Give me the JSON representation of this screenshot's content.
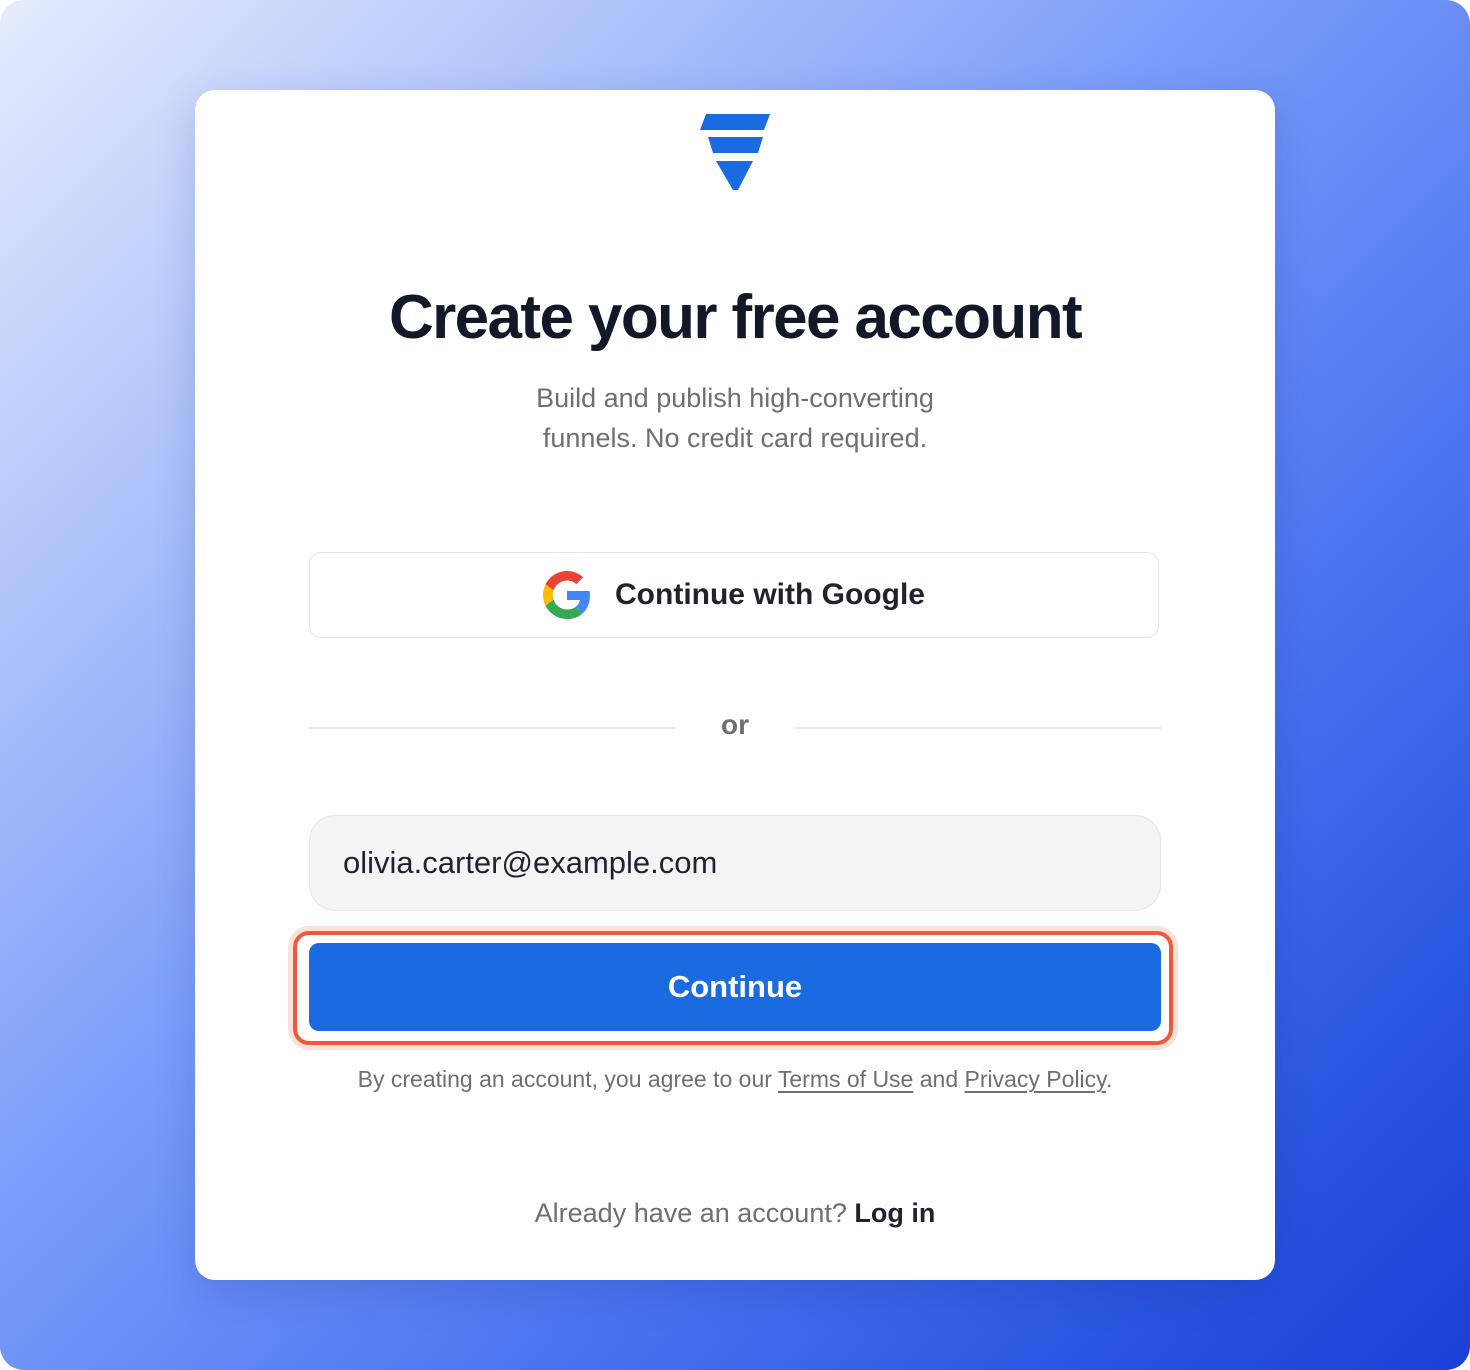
{
  "colors": {
    "brand_blue": "#1a6ae0",
    "highlight_outline": "#f0583a"
  },
  "logo": {
    "icon": "funnel-logo-icon"
  },
  "header": {
    "title": "Create your free account",
    "subtitle_line1": "Build and publish high-converting",
    "subtitle_line2": "funnels. No credit card required."
  },
  "google_button": {
    "icon": "google-icon",
    "label": "Continue with Google"
  },
  "divider": {
    "label": "or"
  },
  "email": {
    "value": "olivia.carter@example.com"
  },
  "continue_button": {
    "label": "Continue"
  },
  "legal": {
    "prefix": "By creating an account, you agree to our ",
    "terms_label": "Terms of Use",
    "middle": " and ",
    "privacy_label": "Privacy Policy",
    "suffix": "."
  },
  "footer": {
    "prompt": "Already have an account? ",
    "login_label": "Log in"
  }
}
